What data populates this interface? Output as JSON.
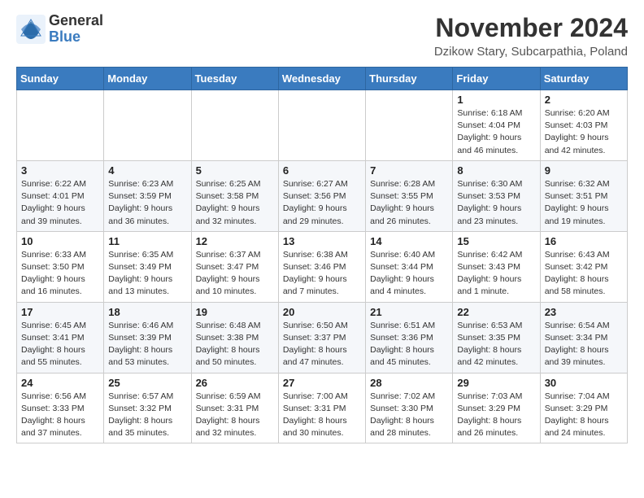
{
  "header": {
    "logo_general": "General",
    "logo_blue": "Blue",
    "title": "November 2024",
    "location": "Dzikow Stary, Subcarpathia, Poland"
  },
  "weekdays": [
    "Sunday",
    "Monday",
    "Tuesday",
    "Wednesday",
    "Thursday",
    "Friday",
    "Saturday"
  ],
  "weeks": [
    [
      {
        "day": "",
        "info": ""
      },
      {
        "day": "",
        "info": ""
      },
      {
        "day": "",
        "info": ""
      },
      {
        "day": "",
        "info": ""
      },
      {
        "day": "",
        "info": ""
      },
      {
        "day": "1",
        "info": "Sunrise: 6:18 AM\nSunset: 4:04 PM\nDaylight: 9 hours\nand 46 minutes."
      },
      {
        "day": "2",
        "info": "Sunrise: 6:20 AM\nSunset: 4:03 PM\nDaylight: 9 hours\nand 42 minutes."
      }
    ],
    [
      {
        "day": "3",
        "info": "Sunrise: 6:22 AM\nSunset: 4:01 PM\nDaylight: 9 hours\nand 39 minutes."
      },
      {
        "day": "4",
        "info": "Sunrise: 6:23 AM\nSunset: 3:59 PM\nDaylight: 9 hours\nand 36 minutes."
      },
      {
        "day": "5",
        "info": "Sunrise: 6:25 AM\nSunset: 3:58 PM\nDaylight: 9 hours\nand 32 minutes."
      },
      {
        "day": "6",
        "info": "Sunrise: 6:27 AM\nSunset: 3:56 PM\nDaylight: 9 hours\nand 29 minutes."
      },
      {
        "day": "7",
        "info": "Sunrise: 6:28 AM\nSunset: 3:55 PM\nDaylight: 9 hours\nand 26 minutes."
      },
      {
        "day": "8",
        "info": "Sunrise: 6:30 AM\nSunset: 3:53 PM\nDaylight: 9 hours\nand 23 minutes."
      },
      {
        "day": "9",
        "info": "Sunrise: 6:32 AM\nSunset: 3:51 PM\nDaylight: 9 hours\nand 19 minutes."
      }
    ],
    [
      {
        "day": "10",
        "info": "Sunrise: 6:33 AM\nSunset: 3:50 PM\nDaylight: 9 hours\nand 16 minutes."
      },
      {
        "day": "11",
        "info": "Sunrise: 6:35 AM\nSunset: 3:49 PM\nDaylight: 9 hours\nand 13 minutes."
      },
      {
        "day": "12",
        "info": "Sunrise: 6:37 AM\nSunset: 3:47 PM\nDaylight: 9 hours\nand 10 minutes."
      },
      {
        "day": "13",
        "info": "Sunrise: 6:38 AM\nSunset: 3:46 PM\nDaylight: 9 hours\nand 7 minutes."
      },
      {
        "day": "14",
        "info": "Sunrise: 6:40 AM\nSunset: 3:44 PM\nDaylight: 9 hours\nand 4 minutes."
      },
      {
        "day": "15",
        "info": "Sunrise: 6:42 AM\nSunset: 3:43 PM\nDaylight: 9 hours\nand 1 minute."
      },
      {
        "day": "16",
        "info": "Sunrise: 6:43 AM\nSunset: 3:42 PM\nDaylight: 8 hours\nand 58 minutes."
      }
    ],
    [
      {
        "day": "17",
        "info": "Sunrise: 6:45 AM\nSunset: 3:41 PM\nDaylight: 8 hours\nand 55 minutes."
      },
      {
        "day": "18",
        "info": "Sunrise: 6:46 AM\nSunset: 3:39 PM\nDaylight: 8 hours\nand 53 minutes."
      },
      {
        "day": "19",
        "info": "Sunrise: 6:48 AM\nSunset: 3:38 PM\nDaylight: 8 hours\nand 50 minutes."
      },
      {
        "day": "20",
        "info": "Sunrise: 6:50 AM\nSunset: 3:37 PM\nDaylight: 8 hours\nand 47 minutes."
      },
      {
        "day": "21",
        "info": "Sunrise: 6:51 AM\nSunset: 3:36 PM\nDaylight: 8 hours\nand 45 minutes."
      },
      {
        "day": "22",
        "info": "Sunrise: 6:53 AM\nSunset: 3:35 PM\nDaylight: 8 hours\nand 42 minutes."
      },
      {
        "day": "23",
        "info": "Sunrise: 6:54 AM\nSunset: 3:34 PM\nDaylight: 8 hours\nand 39 minutes."
      }
    ],
    [
      {
        "day": "24",
        "info": "Sunrise: 6:56 AM\nSunset: 3:33 PM\nDaylight: 8 hours\nand 37 minutes."
      },
      {
        "day": "25",
        "info": "Sunrise: 6:57 AM\nSunset: 3:32 PM\nDaylight: 8 hours\nand 35 minutes."
      },
      {
        "day": "26",
        "info": "Sunrise: 6:59 AM\nSunset: 3:31 PM\nDaylight: 8 hours\nand 32 minutes."
      },
      {
        "day": "27",
        "info": "Sunrise: 7:00 AM\nSunset: 3:31 PM\nDaylight: 8 hours\nand 30 minutes."
      },
      {
        "day": "28",
        "info": "Sunrise: 7:02 AM\nSunset: 3:30 PM\nDaylight: 8 hours\nand 28 minutes."
      },
      {
        "day": "29",
        "info": "Sunrise: 7:03 AM\nSunset: 3:29 PM\nDaylight: 8 hours\nand 26 minutes."
      },
      {
        "day": "30",
        "info": "Sunrise: 7:04 AM\nSunset: 3:29 PM\nDaylight: 8 hours\nand 24 minutes."
      }
    ]
  ]
}
